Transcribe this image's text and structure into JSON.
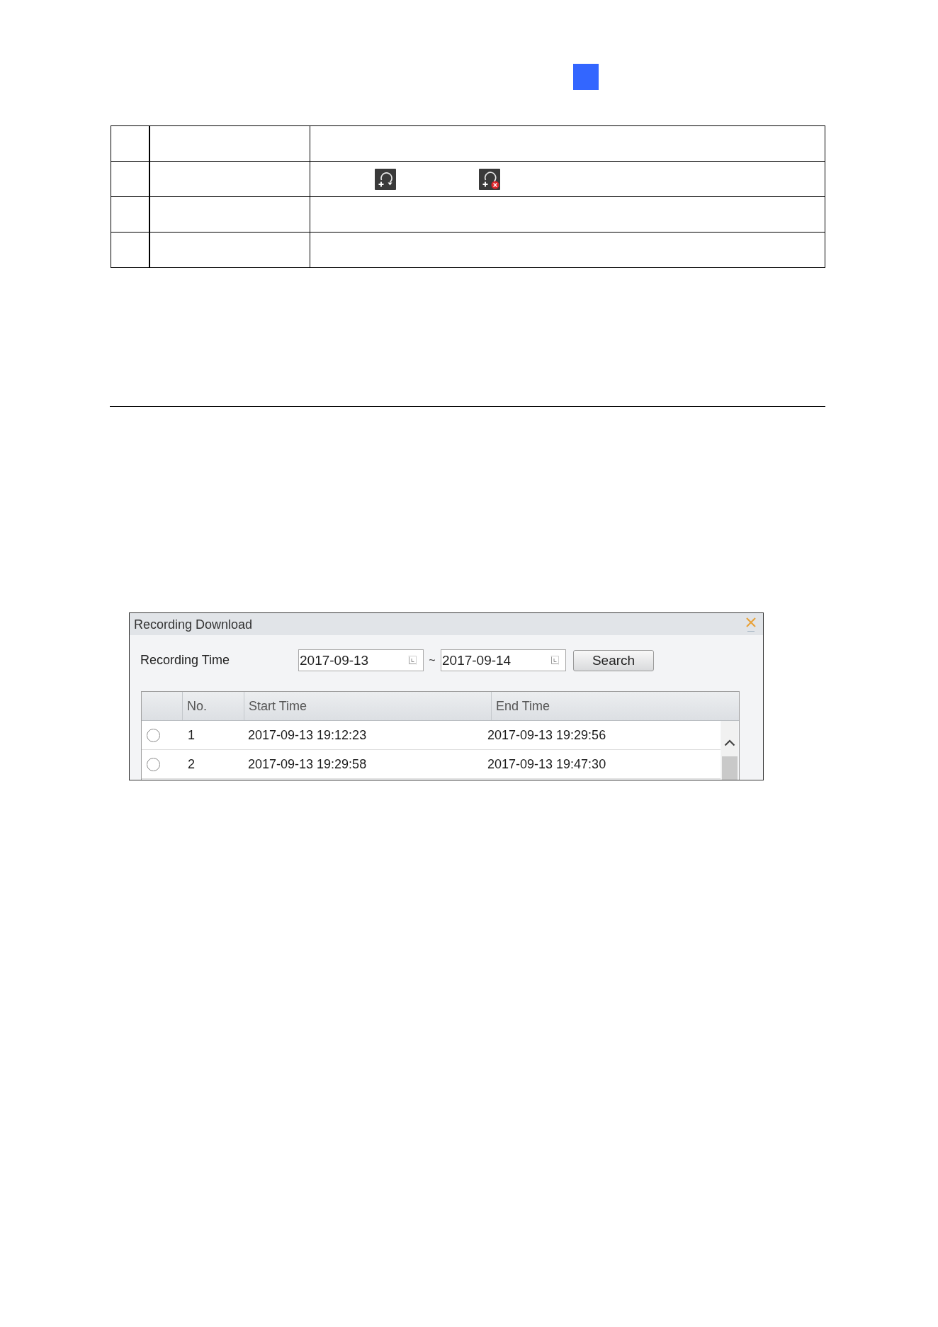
{
  "doc_table": {
    "rows": [
      {
        "kind": "plain"
      },
      {
        "kind": "icons"
      },
      {
        "kind": "plain"
      },
      {
        "kind": "plain"
      }
    ]
  },
  "dialog": {
    "title": "Recording Download",
    "filter": {
      "label": "Recording Time",
      "from": {
        "value": "2017-09-13"
      },
      "separator": "~",
      "to": {
        "value": "2017-09-14"
      },
      "button": "Search"
    },
    "grid": {
      "columns": [
        "No.",
        "Start Time",
        "End Time"
      ],
      "rows": [
        {
          "selected": false,
          "no": "1",
          "start": "2017-09-13 19:12:23",
          "end": "2017-09-13 19:29:56"
        },
        {
          "selected": false,
          "no": "2",
          "start": "2017-09-13 19:29:58",
          "end": "2017-09-13 19:47:30"
        }
      ]
    }
  }
}
